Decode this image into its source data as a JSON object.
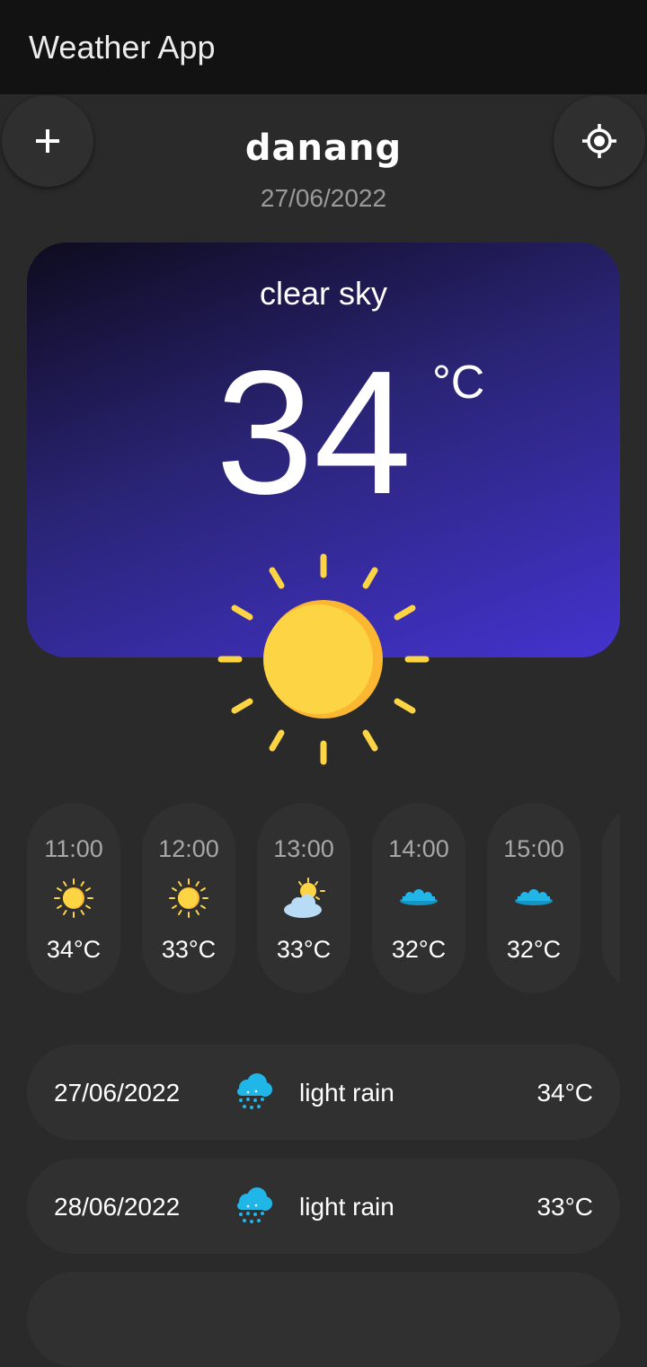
{
  "app_bar": {
    "title": "Weather App"
  },
  "header": {
    "add_button": {
      "icon": "plus-icon"
    },
    "location_button": {
      "icon": "crosshair-location-icon"
    },
    "city": "danang",
    "date": "27/06/2022"
  },
  "current": {
    "description": "clear sky",
    "temperature": "34",
    "unit": "°C",
    "icon": "sun-icon"
  },
  "hourly": [
    {
      "time": "11:00",
      "temp": "34°C",
      "icon": "sun-icon"
    },
    {
      "time": "12:00",
      "temp": "33°C",
      "icon": "sun-icon"
    },
    {
      "time": "13:00",
      "temp": "33°C",
      "icon": "sun-behind-cloud-icon"
    },
    {
      "time": "14:00",
      "temp": "32°C",
      "icon": "clouds-icon"
    },
    {
      "time": "15:00",
      "temp": "32°C",
      "icon": "clouds-icon"
    }
  ],
  "daily": [
    {
      "date": "27/06/2022",
      "description": "light rain",
      "temp": "34°C",
      "icon": "rain-cloud-icon"
    },
    {
      "date": "28/06/2022",
      "description": "light rain",
      "temp": "33°C",
      "icon": "rain-cloud-icon"
    }
  ],
  "colors": {
    "background": "#2a2a2a",
    "app_bar": "#121212",
    "card_gradient_start": "#0e0b1e",
    "card_gradient_end": "#4433cf",
    "sun_yellow": "#fdd444",
    "cloud_blue": "#21b6e8"
  }
}
